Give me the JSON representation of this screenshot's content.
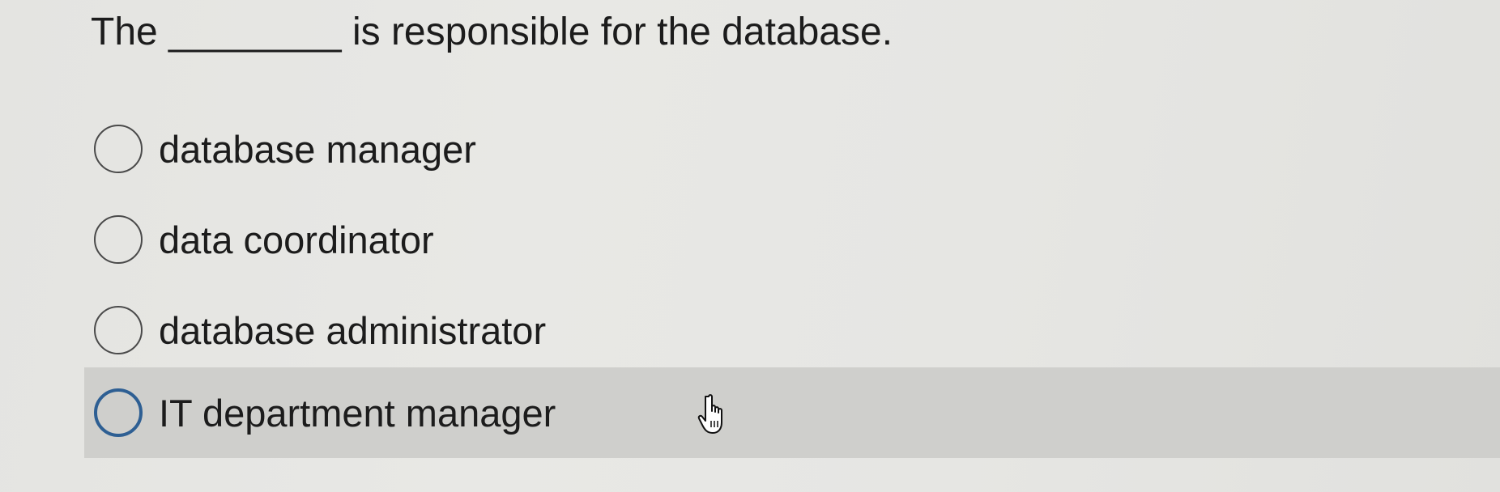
{
  "question": {
    "text": "The ________ is responsible for the database."
  },
  "options": [
    {
      "label": "database manager",
      "selected": false
    },
    {
      "label": "data coordinator",
      "selected": false
    },
    {
      "label": "database administrator",
      "selected": false
    },
    {
      "label": "IT department manager",
      "selected": false,
      "hovered": true
    }
  ],
  "colors": {
    "background": "#e6e6e3",
    "hover_row": "#cfcfcc",
    "hover_radio": "#2e5f93",
    "text": "#1c1c1c"
  },
  "icons": {
    "cursor": "hand-pointer-icon"
  }
}
